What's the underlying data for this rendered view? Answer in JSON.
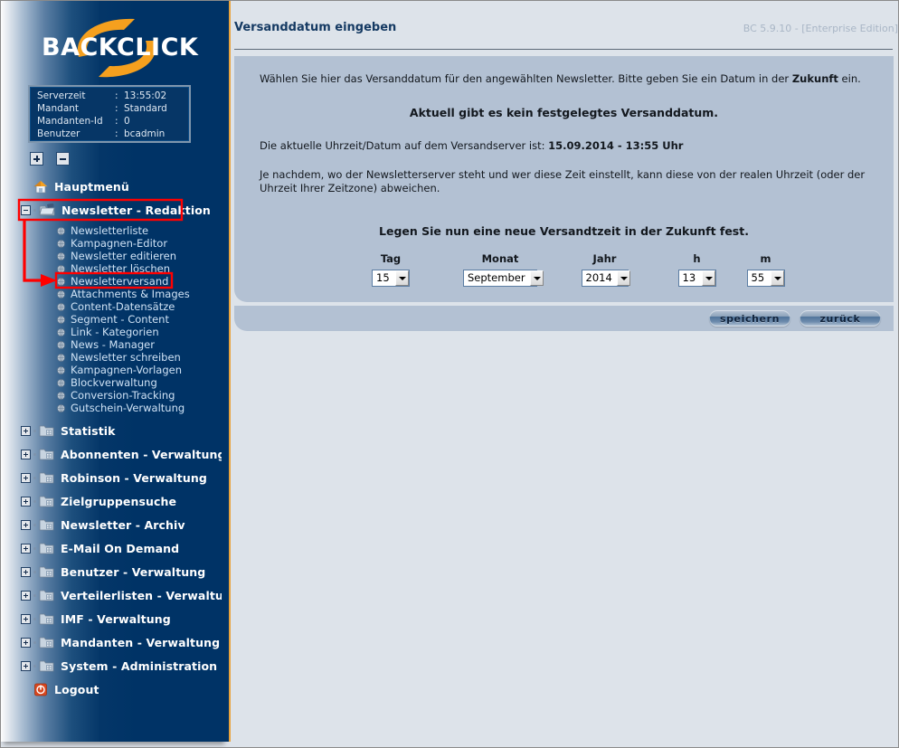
{
  "app": {
    "logo_text": "BACKCLICK",
    "brand_orange": "#F5A01E",
    "sidebar_navy": "#003366",
    "accent_gold": "#E8A33D"
  },
  "serverinfo": {
    "rows": [
      {
        "key": "Serverzeit",
        "sep": ":",
        "value": "13:55:02"
      },
      {
        "key": "Mandant",
        "sep": ":",
        "value": "Standard"
      },
      {
        "key": "Mandanten-Id",
        "sep": ":",
        "value": "0"
      },
      {
        "key": "Benutzer",
        "sep": ":",
        "value": "bcadmin"
      }
    ]
  },
  "treetools": {
    "expand_all": "+",
    "collapse_all": "-"
  },
  "sidebar": {
    "items": [
      {
        "label": "Hauptmenü",
        "icon": "home-icon",
        "toggle": "none"
      },
      {
        "label": "Newsletter - Redaktion",
        "icon": "folder-open-icon",
        "toggle": "minus",
        "expanded": true,
        "highlighted": true
      },
      {
        "label": "Statistik",
        "icon": "folder-icon",
        "toggle": "plus"
      },
      {
        "label": "Abonnenten - Verwaltung",
        "icon": "folder-icon",
        "toggle": "plus"
      },
      {
        "label": "Robinson - Verwaltung",
        "icon": "folder-icon",
        "toggle": "plus"
      },
      {
        "label": "Zielgruppensuche",
        "icon": "folder-icon",
        "toggle": "plus"
      },
      {
        "label": "Newsletter - Archiv",
        "icon": "folder-icon",
        "toggle": "plus"
      },
      {
        "label": "E-Mail On Demand",
        "icon": "folder-icon",
        "toggle": "plus"
      },
      {
        "label": "Benutzer - Verwaltung",
        "icon": "folder-icon",
        "toggle": "plus"
      },
      {
        "label": "Verteilerlisten - Verwaltung",
        "icon": "folder-icon",
        "toggle": "plus"
      },
      {
        "label": "IMF - Verwaltung",
        "icon": "folder-icon",
        "toggle": "plus"
      },
      {
        "label": "Mandanten - Verwaltung",
        "icon": "folder-icon",
        "toggle": "plus"
      },
      {
        "label": "System - Administration",
        "icon": "folder-icon",
        "toggle": "plus"
      },
      {
        "label": "Logout",
        "icon": "logout-icon",
        "toggle": "none"
      }
    ],
    "submenu": [
      {
        "label": "Newsletterliste"
      },
      {
        "label": "Kampagnen-Editor"
      },
      {
        "label": "Newsletter editieren"
      },
      {
        "label": "Newsletter löschen"
      },
      {
        "label": "Newsletterversand",
        "highlighted": true
      },
      {
        "label": "Attachments & Images"
      },
      {
        "label": "Content-Datensätze"
      },
      {
        "label": "Segment - Content"
      },
      {
        "label": "Link - Kategorien"
      },
      {
        "label": "News - Manager"
      },
      {
        "label": "Newsletter schreiben"
      },
      {
        "label": "Kampagnen-Vorlagen"
      },
      {
        "label": "Blockverwaltung"
      },
      {
        "label": "Conversion-Tracking"
      },
      {
        "label": "Gutschein-Verwaltung"
      }
    ]
  },
  "annotation": {
    "color": "#FF0000",
    "boxes": [
      "Newsletter - Redaktion",
      "Newsletterversand"
    ],
    "arrow": "points-to-newsletterversand"
  },
  "header": {
    "title": "Versanddatum eingeben",
    "version": "BC 5.9.10 - [Enterprise Edition]"
  },
  "main": {
    "intro_a": "Wählen Sie hier das Versanddatum für den angewählten Newsletter. Bitte geben Sie ein Datum in der ",
    "intro_bold": "Zukunft",
    "intro_b": " ein.",
    "status": "Aktuell gibt es kein festgelegtes Versanddatum.",
    "servertime_label": "Die aktuelle Uhrzeit/Datum auf dem Versandserver ist: ",
    "servertime_value": "15.09.2014 - 13:55 Uhr",
    "note": "Je nachdem, wo der Newsletterserver steht und wer diese Zeit einstellt, kann diese von der realen Uhrzeit (oder der Uhrzeit Ihrer Zeitzone) abweichen.",
    "legend": "Legen Sie nun eine neue Versandtzeit in der Zukunft fest."
  },
  "selectors": [
    {
      "caption": "Tag",
      "value": "15",
      "name": "day-select"
    },
    {
      "caption": "Monat",
      "value": "September",
      "name": "month-select"
    },
    {
      "caption": "Jahr",
      "value": "2014",
      "name": "year-select"
    },
    {
      "caption": "h",
      "value": "13",
      "name": "hour-select"
    },
    {
      "caption": "m",
      "value": "55",
      "name": "minute-select"
    }
  ],
  "buttons": {
    "save": "speichern",
    "back": "zurück"
  }
}
